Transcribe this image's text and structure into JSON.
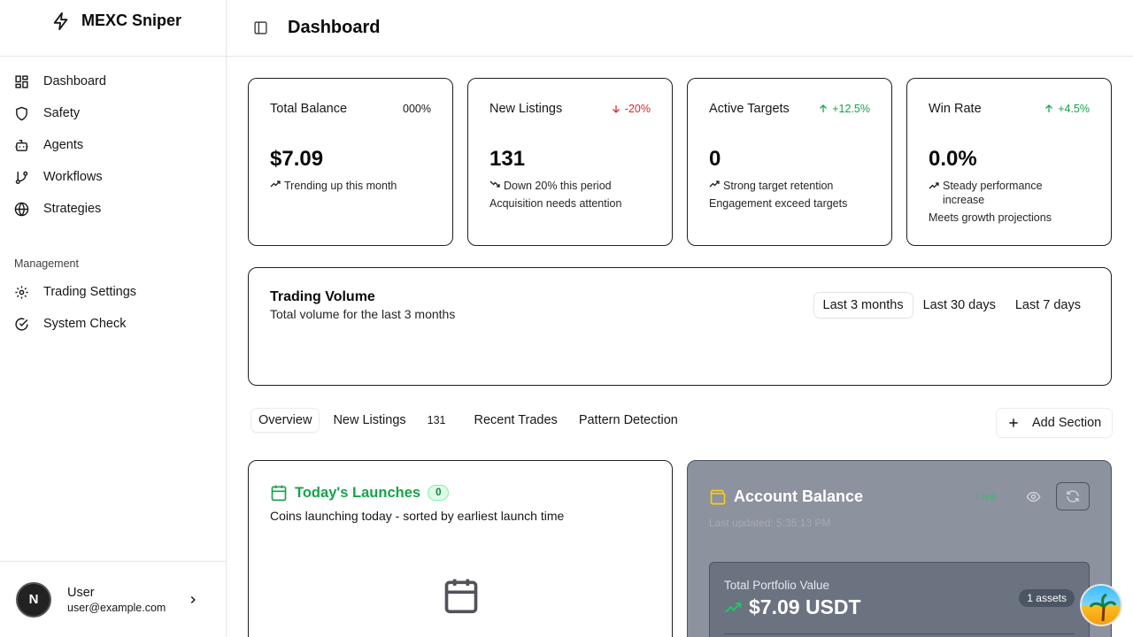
{
  "sidebar": {
    "brand": "MEXC Sniper",
    "items": [
      {
        "label": "Dashboard",
        "icon": "dashboard-icon"
      },
      {
        "label": "Safety",
        "icon": "shield-icon"
      },
      {
        "label": "Agents",
        "icon": "bot-icon"
      },
      {
        "label": "Workflows",
        "icon": "git-branch-icon"
      },
      {
        "label": "Strategies",
        "icon": "globe-icon"
      }
    ],
    "group_label": "Management",
    "management_items": [
      {
        "label": "Trading Settings",
        "icon": "gear-icon"
      },
      {
        "label": "System Check",
        "icon": "check-circle-icon"
      }
    ],
    "user": {
      "initial": "N",
      "name": "User",
      "email": "user@example.com"
    }
  },
  "header": {
    "title": "Dashboard"
  },
  "stats": [
    {
      "title": "Total Balance",
      "change": "000%",
      "value": "$7.09",
      "note": "Trending up this month",
      "sub": "",
      "trend": "neutral"
    },
    {
      "title": "New Listings",
      "change": "-20%",
      "value": "131",
      "note": "Down 20% this period",
      "sub": "Acquisition needs attention",
      "trend": "down"
    },
    {
      "title": "Active Targets",
      "change": "+12.5%",
      "value": "0",
      "note": "Strong target retention",
      "sub": "Engagement exceed targets",
      "trend": "up"
    },
    {
      "title": "Win Rate",
      "change": "+4.5%",
      "value": "0.0%",
      "note": "Steady performance increase",
      "sub": "Meets growth projections",
      "trend": "up"
    }
  ],
  "volume": {
    "title": "Trading Volume",
    "desc": "Total volume for the last 3 months",
    "ranges": [
      "Last 3 months",
      "Last 30 days",
      "Last 7 days"
    ],
    "active_range": "Last 3 months"
  },
  "tabs": {
    "items": [
      "Overview",
      "New Listings",
      "Recent Trades",
      "Pattern Detection"
    ],
    "new_listings_count": "131",
    "add_section": "Add Section"
  },
  "launches": {
    "title": "Today's Launches",
    "count": "0",
    "desc": "Coins launching today - sorted by earliest launch time"
  },
  "balance": {
    "title": "Account Balance",
    "live": "Live",
    "updated": "Last updated: 5:35:13 PM",
    "portfolio_label": "Total Portfolio Value",
    "portfolio_value": "$7.09 USDT",
    "assets": "1 assets"
  },
  "colors": {
    "positive": "#16a34a",
    "negative": "#dc2626",
    "balance_card": "#8c929e"
  }
}
